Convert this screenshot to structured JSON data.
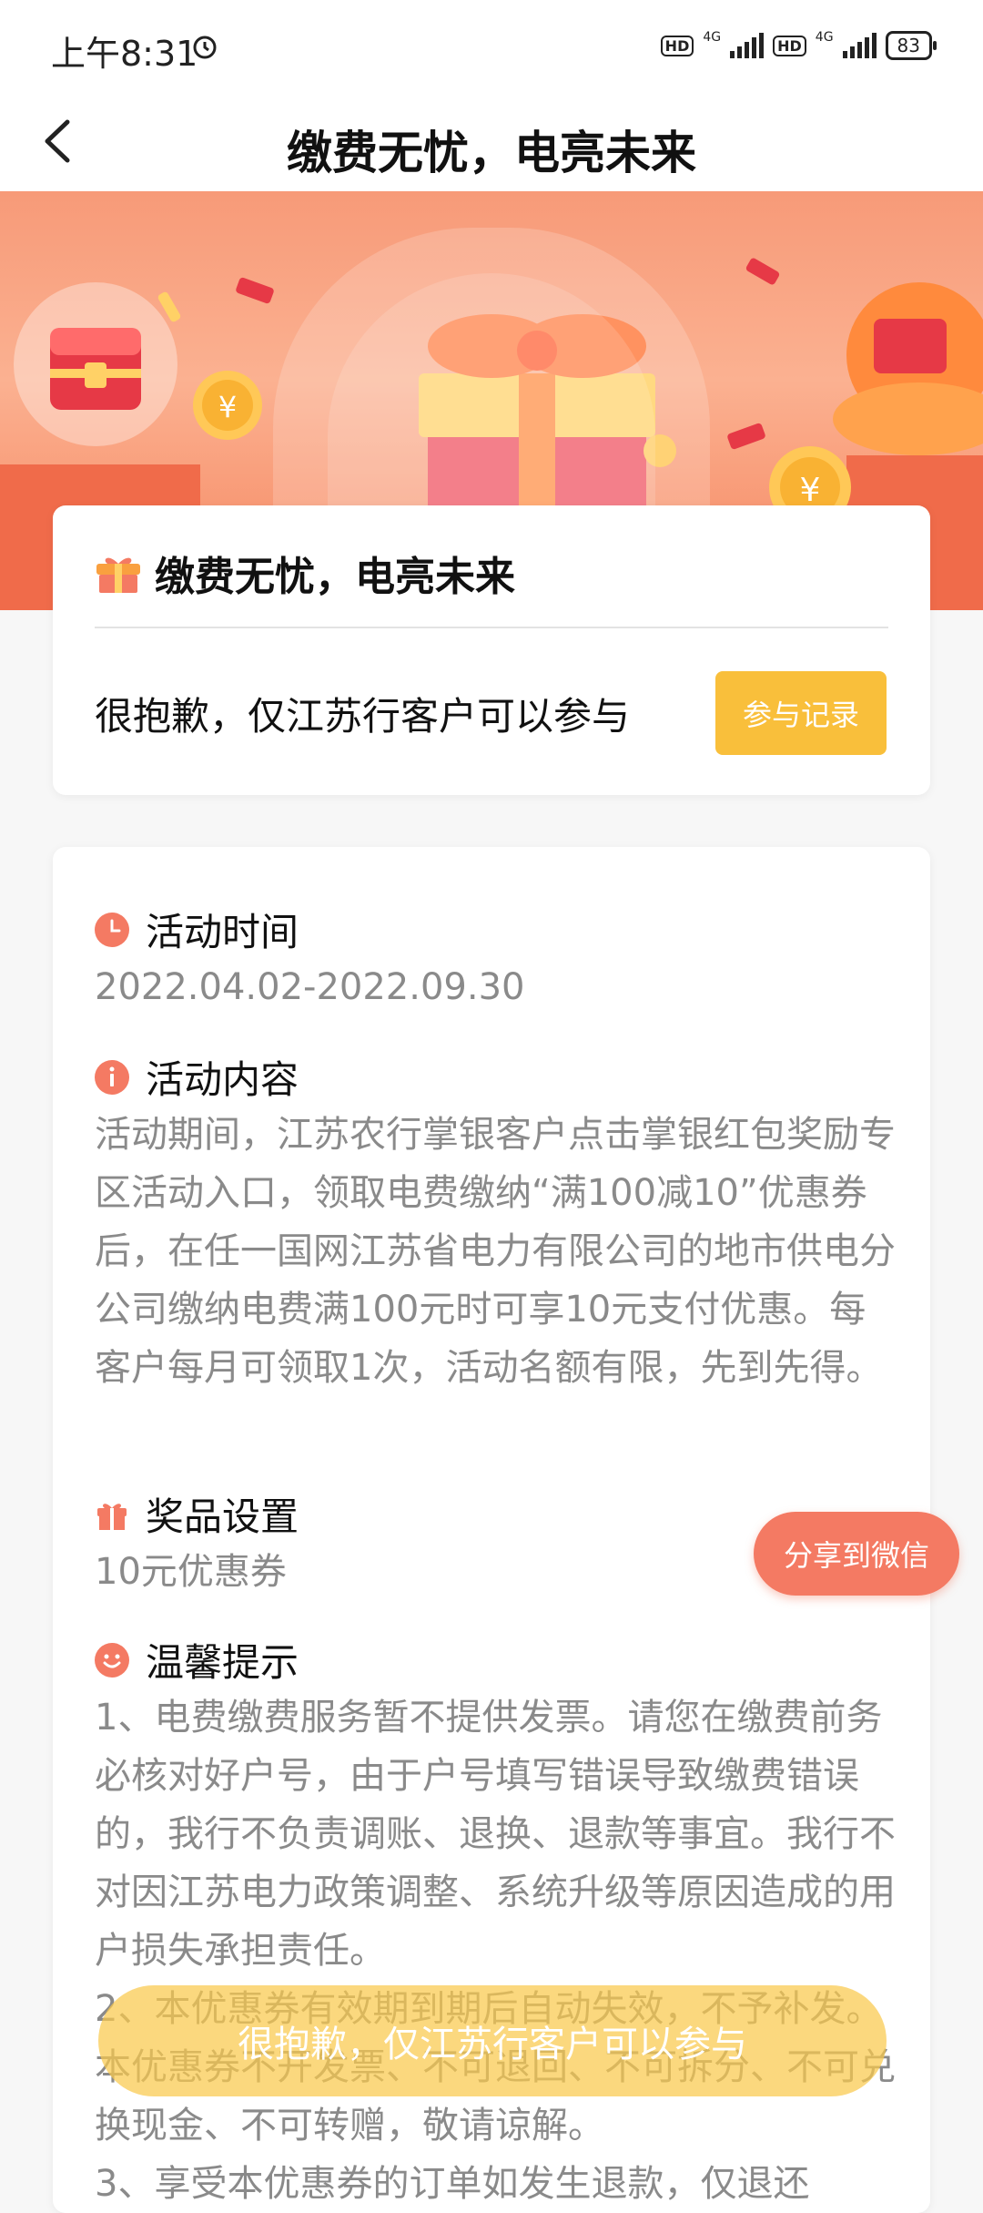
{
  "status_bar": {
    "time": "上午8:31",
    "hd_label": "HD",
    "network_1": "4G",
    "network_2": "4G",
    "battery": "83"
  },
  "nav": {
    "title": "缴费无忧，电亮未来"
  },
  "header_card": {
    "title": "缴费无忧，电亮未来",
    "notice": "很抱歉，仅江苏行客户可以参与",
    "record_button": "参与记录"
  },
  "sections": {
    "time": {
      "title": "活动时间",
      "body": "2022.04.02-2022.09.30"
    },
    "content": {
      "title": "活动内容",
      "body": "活动期间，江苏农行掌银客户点击掌银红包奖励专区活动入口，领取电费缴纳“满100减10”优惠券后，在任一国网江苏省电力有限公司的地市供电分公司缴纳电费满100元时可享10元支付优惠。每客户每月可领取1次，活动名额有限，先到先得。"
    },
    "prize": {
      "title": "奖品设置",
      "body": "10元优惠券"
    },
    "tips": {
      "title": "温馨提示",
      "body1": "1、电费缴费服务暂不提供发票。请您在缴费前务必核对好户号，由于户号填写错误导致缴费错误的，我行不负责调账、退换、退款等事宜。我行不对因江苏电力政策调整、系统升级等原因造成的用户损失承担责任。",
      "body2": "2、本优惠券有效期到期后自动失效，不予补发。本优惠券不开发票、不可退回、不可拆分、不可兑换现金、不可转赠，敬请谅解。",
      "body3": "3、享受本优惠券的订单如发生退款，仅退还"
    }
  },
  "share_button": "分享到微信",
  "toast": "很抱歉，仅江苏行客户可以参与",
  "colors": {
    "accent_orange": "#f47a63",
    "button_yellow": "#f9bf3b",
    "icon_orange": "#f47a63",
    "body_gray": "#8a8a8a"
  }
}
